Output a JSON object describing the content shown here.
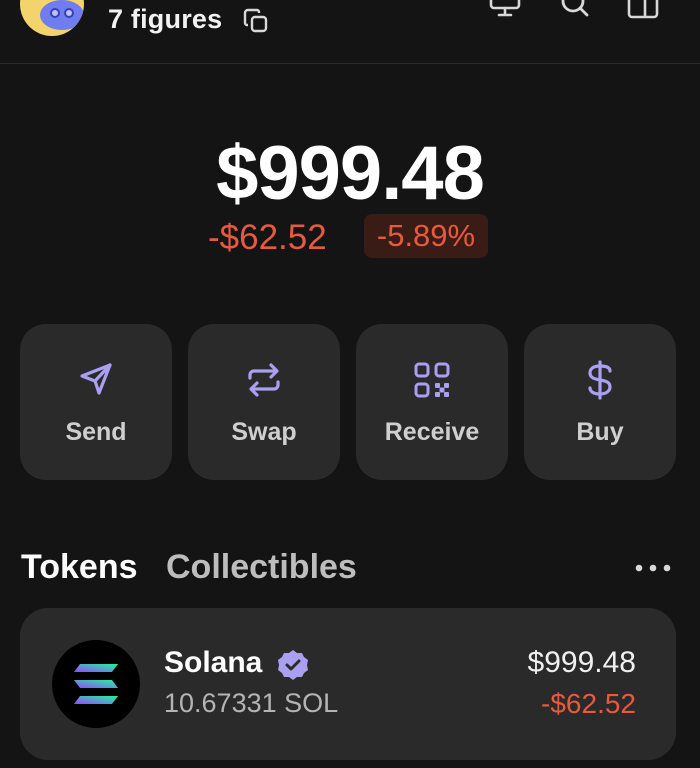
{
  "header": {
    "account_name": "7 figures",
    "icons": [
      "copy-icon",
      "desktop-icon",
      "search-icon",
      "sidebar-icon"
    ]
  },
  "portfolio": {
    "balance": "$999.48",
    "change_amount": "-$62.52",
    "change_percent": "-5.89%"
  },
  "actions": [
    {
      "label": "Send",
      "icon": "send-icon"
    },
    {
      "label": "Swap",
      "icon": "swap-icon"
    },
    {
      "label": "Receive",
      "icon": "qr-code-icon"
    },
    {
      "label": "Buy",
      "icon": "dollar-icon"
    }
  ],
  "tabs": {
    "tokens": "Tokens",
    "collectibles": "Collectibles",
    "active": "Tokens"
  },
  "tokens": [
    {
      "name": "Solana",
      "amount": "10.67331 SOL",
      "value": "$999.48",
      "change": "-$62.52",
      "verified": true
    }
  ],
  "colors": {
    "background": "#141414",
    "card": "#2a2a2a",
    "accent": "#ab9ff2",
    "negative": "#e8593e"
  }
}
